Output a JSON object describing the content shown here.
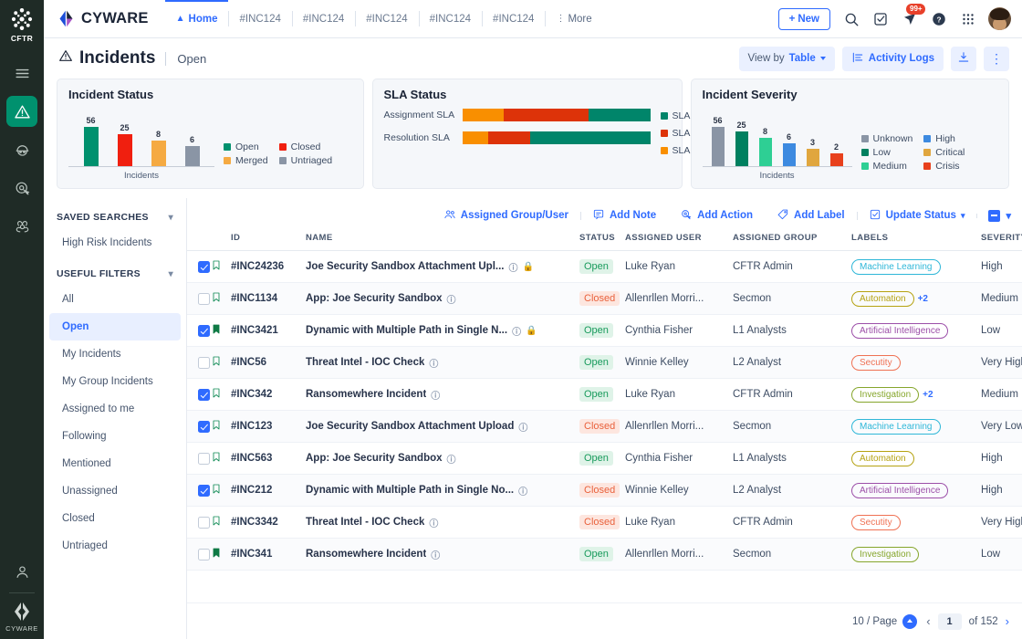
{
  "rail": {
    "top_label": "CFTR",
    "bottom_label": "CYWARE",
    "icons": [
      {
        "name": "menu-icon"
      },
      {
        "name": "incidents-icon"
      },
      {
        "name": "threat-actor-icon"
      },
      {
        "name": "hunt-icon"
      },
      {
        "name": "malware-icon"
      }
    ],
    "profile_icon": "user-icon"
  },
  "topnav": {
    "brand": "CYWARE",
    "tabs": [
      {
        "label": "Home",
        "icon": "home-icon",
        "active": true
      },
      {
        "label": "#INC124",
        "active": false
      },
      {
        "label": "#INC124",
        "active": false
      },
      {
        "label": "#INC124",
        "active": false
      },
      {
        "label": "#INC124",
        "active": false
      },
      {
        "label": "#INC124",
        "active": false
      }
    ],
    "more_label": "More",
    "new_button": "New",
    "notification_badge": "99+",
    "icons": [
      "search-icon",
      "tasks-icon",
      "notification-icon",
      "help-icon",
      "apps-grid-icon",
      "avatar"
    ]
  },
  "pagehead": {
    "title": "Incidents",
    "subtitle": "Open",
    "view_by_prefix": "View by",
    "view_by_value": "Table",
    "activity_logs": "Activity Logs",
    "download_icon": "download-icon",
    "more_icon": "kebab-menu-icon"
  },
  "widgets": {
    "incident_status": {
      "title": "Incident Status",
      "xlabel": "Incidents",
      "legend": [
        "Open",
        "Closed",
        "Merged",
        "Untriaged"
      ]
    },
    "sla_status": {
      "title": "SLA Status",
      "rows": [
        "Assignment SLA",
        "Resolution SLA"
      ],
      "legend": [
        "SLA Met",
        "SLA Breached",
        "SLA In Risk"
      ]
    },
    "incident_severity": {
      "title": "Incident Severity",
      "xlabel": "Incidents",
      "legend": [
        "Unknown",
        "High",
        "Low",
        "Critical",
        "Medium",
        "Crisis"
      ]
    }
  },
  "chart_data": [
    {
      "type": "bar",
      "title": "Incident Status",
      "categories": [
        "Open",
        "Closed",
        "Merged",
        "Untriaged"
      ],
      "values": [
        56,
        25,
        8,
        6
      ],
      "colors": [
        "#00916e",
        "#f01f0f",
        "#f5aa42",
        "#8a95a5"
      ],
      "xlabel": "Incidents",
      "ylabel": "",
      "ylim": [
        0,
        60
      ],
      "grid": false,
      "legend_position": "right"
    },
    {
      "type": "bar",
      "orientation": "horizontal-stacked",
      "title": "SLA Status",
      "categories": [
        "Assignment SLA",
        "Resolution SLA"
      ],
      "series": [
        {
          "name": "SLA In Risk",
          "values": [
            22,
            14
          ],
          "color": "#f98f00"
        },
        {
          "name": "SLA Breached",
          "values": [
            45,
            22
          ],
          "color": "#dd3309"
        },
        {
          "name": "SLA Met",
          "values": [
            33,
            64
          ],
          "color": "#00856a"
        }
      ],
      "xlabel": "",
      "ylabel": "",
      "legend_position": "right"
    },
    {
      "type": "bar",
      "title": "Incident Severity",
      "categories": [
        "Unknown",
        "Low",
        "Medium",
        "High",
        "Critical",
        "Crisis"
      ],
      "values": [
        56,
        25,
        8,
        6,
        3,
        2
      ],
      "colors": [
        "#8a95a5",
        "#00805f",
        "#2ecf94",
        "#3d8ae0",
        "#e0a63e",
        "#e8401c"
      ],
      "xlabel": "Incidents",
      "ylabel": "",
      "ylim": [
        0,
        60
      ],
      "grid": false,
      "legend_position": "right"
    }
  ],
  "sidebar": {
    "saved_searches_header": "SAVED SEARCHES",
    "saved_searches": [
      {
        "label": "High Risk Incidents"
      }
    ],
    "useful_filters_header": "USEFUL FILTERS",
    "useful_filters": [
      {
        "label": "All",
        "active": false
      },
      {
        "label": "Open",
        "active": true
      },
      {
        "label": "My Incidents",
        "active": false
      },
      {
        "label": "My Group Incidents",
        "active": false
      },
      {
        "label": "Assigned to me",
        "active": false
      },
      {
        "label": "Following",
        "active": false
      },
      {
        "label": "Mentioned",
        "active": false
      },
      {
        "label": "Unassigned",
        "active": false
      },
      {
        "label": "Closed",
        "active": false
      },
      {
        "label": "Untriaged",
        "active": false
      }
    ]
  },
  "bulkbar": {
    "actions": [
      {
        "label": "Assigned Group/User",
        "icon": "assign-users-icon"
      },
      {
        "label": "Add Note",
        "icon": "note-icon"
      },
      {
        "label": "Add Action",
        "icon": "action-icon"
      },
      {
        "label": "Add Label",
        "icon": "label-tag-icon"
      },
      {
        "label": "Update Status",
        "icon": "update-status-icon"
      }
    ]
  },
  "table": {
    "headers": [
      "ID",
      "NAME",
      "STATUS",
      "ASSIGNED USER",
      "ASSIGNED GROUP",
      "LABELS",
      "SEVERITY"
    ],
    "rows": [
      {
        "checked": true,
        "flag": "outline",
        "id": "#INC24236",
        "name": "Joe Security Sandbox Attachment Upl...",
        "info": true,
        "lock": true,
        "status": "Open",
        "user": "Luke Ryan",
        "group": "CFTR Admin",
        "label": "Machine Learning",
        "label_color": "#2fb7d8",
        "extra": "",
        "severity": "High"
      },
      {
        "checked": false,
        "flag": "outline",
        "id": "#INC1134",
        "name": "App: Joe Security Sandbox",
        "info": true,
        "lock": false,
        "status": "Closed",
        "user": "Allenrllen Morri...",
        "group": "Secmon",
        "label": "Automation",
        "label_color": "#b5a211",
        "extra": "+2",
        "severity": "Medium"
      },
      {
        "checked": true,
        "flag": "solid",
        "id": "#INC3421",
        "name": "Dynamic with Multiple Path in Single N...",
        "info": true,
        "lock": true,
        "status": "Open",
        "user": "Cynthia Fisher",
        "group": "L1 Analysts",
        "label": "Artificial Intelligence",
        "label_color": "#9c4fa8",
        "extra": "",
        "severity": "Low"
      },
      {
        "checked": false,
        "flag": "outline",
        "id": "#INC56",
        "name": "Threat Intel - IOC Check",
        "info": true,
        "lock": false,
        "status": "Open",
        "user": "Winnie Kelley",
        "group": "L2 Analyst",
        "label": "Secutity",
        "label_color": "#ef7153",
        "extra": "",
        "severity": "Very High"
      },
      {
        "checked": true,
        "flag": "outline",
        "id": "#INC342",
        "name": "Ransomewhere Incident",
        "info": true,
        "lock": false,
        "status": "Open",
        "user": "Luke Ryan",
        "group": "CFTR Admin",
        "label": "Investigation",
        "label_color": "#86a62c",
        "extra": "+2",
        "severity": "Medium"
      },
      {
        "checked": true,
        "flag": "outline",
        "id": "#INC123",
        "name": "Joe Security Sandbox Attachment Upload",
        "info": true,
        "lock": false,
        "status": "Closed",
        "user": "Allenrllen Morri...",
        "group": "Secmon",
        "label": "Machine Learning",
        "label_color": "#2fb7d8",
        "extra": "",
        "severity": "Very Low"
      },
      {
        "checked": false,
        "flag": "outline",
        "id": "#INC563",
        "name": "App: Joe Security Sandbox",
        "info": true,
        "lock": false,
        "status": "Open",
        "user": "Cynthia Fisher",
        "group": "L1 Analysts",
        "label": "Automation",
        "label_color": "#b5a211",
        "extra": "",
        "severity": "High"
      },
      {
        "checked": true,
        "flag": "outline",
        "id": "#INC212",
        "name": "Dynamic with Multiple Path in Single No...",
        "info": true,
        "lock": false,
        "status": "Closed",
        "user": "Winnie Kelley",
        "group": "L2 Analyst",
        "label": "Artificial Intelligence",
        "label_color": "#9c4fa8",
        "extra": "",
        "severity": "High"
      },
      {
        "checked": false,
        "flag": "outline",
        "id": "#INC3342",
        "name": "Threat Intel - IOC Check",
        "info": true,
        "lock": false,
        "status": "Closed",
        "user": "Luke Ryan",
        "group": "CFTR Admin",
        "label": "Secutity",
        "label_color": "#ef7153",
        "extra": "",
        "severity": "Very High"
      },
      {
        "checked": false,
        "flag": "solid",
        "id": "#INC341",
        "name": "Ransomewhere Incident",
        "info": true,
        "lock": false,
        "status": "Open",
        "user": "Allenrllen Morri...",
        "group": "Secmon",
        "label": "Investigation",
        "label_color": "#86a62c",
        "extra": "",
        "severity": "Low"
      }
    ]
  },
  "footer": {
    "page_size": "10 / Page",
    "current_page": "1",
    "of_label": "of 152"
  }
}
